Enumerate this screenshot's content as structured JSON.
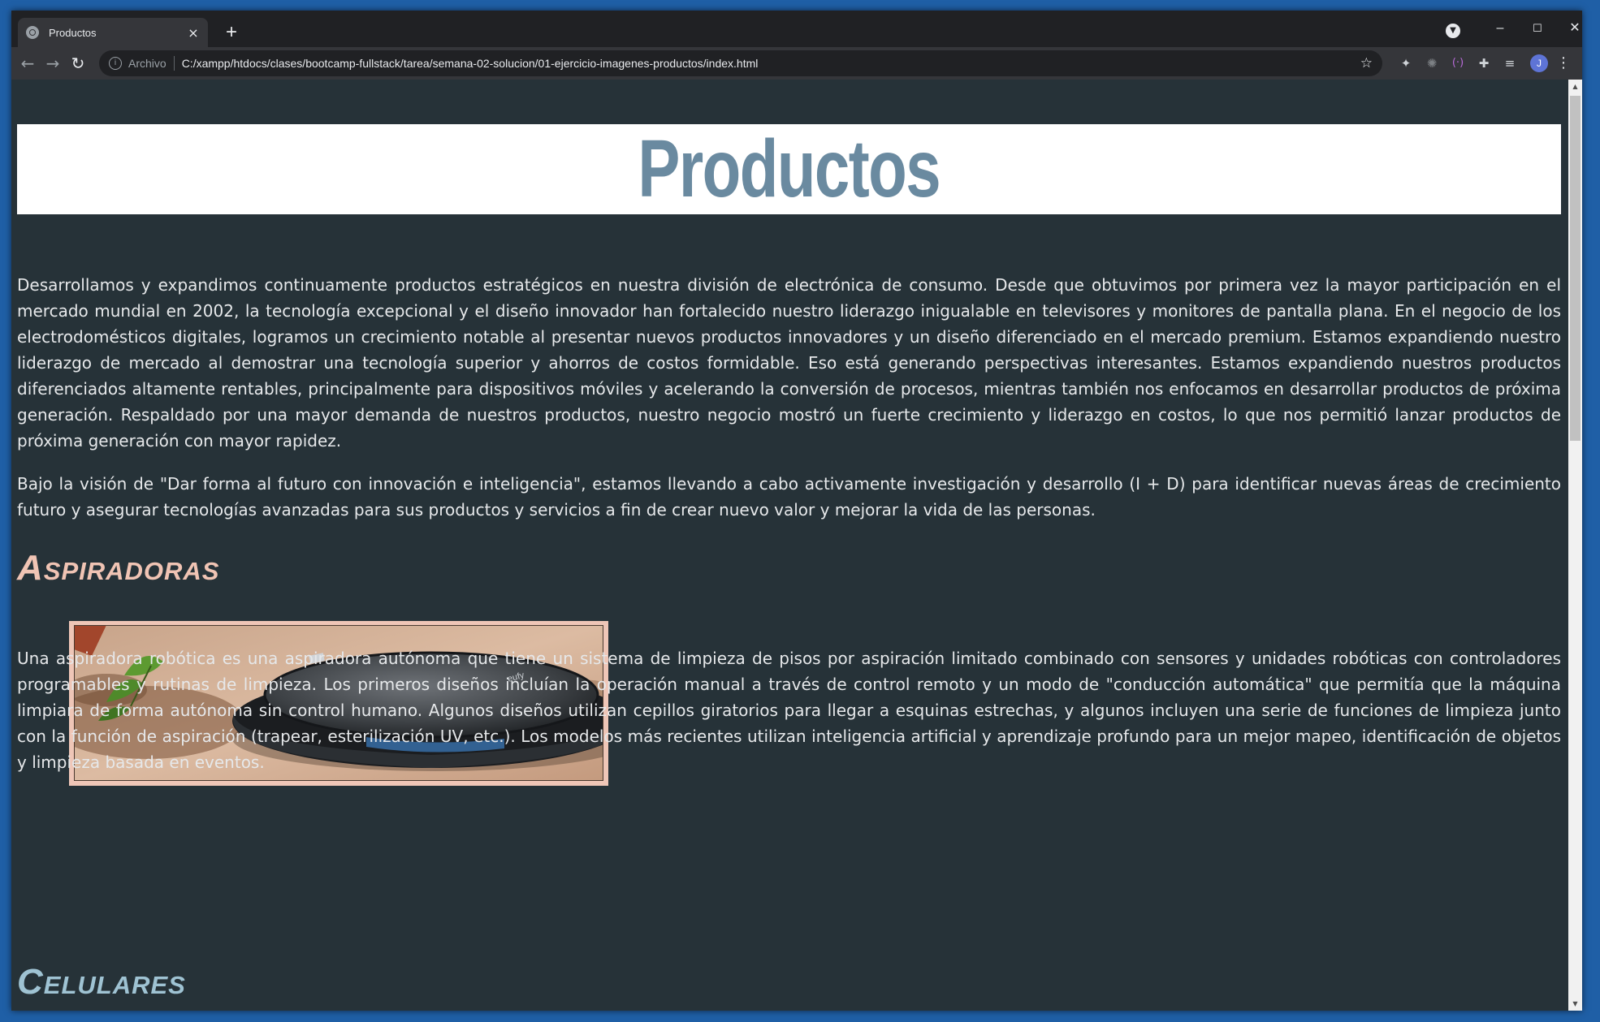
{
  "browser": {
    "tab_title": "Productos",
    "tab_close": "×",
    "new_tab": "+",
    "security_label": "Archivo",
    "url": "C:/xampp/htdocs/clases/bootcamp-fullstack/tarea/semana-02-solucion/01-ejercicio-imagenes-productos/index.html",
    "profile_initial": "J",
    "window_controls": {
      "minimize": "–",
      "maximize": "☐",
      "close": "✕"
    }
  },
  "page": {
    "title": "Productos",
    "intro_paragraphs": [
      "Desarrollamos y expandimos continuamente productos estratégicos en nuestra división de electrónica de consumo. Desde que obtuvimos por primera vez la mayor participación en el mercado mundial en 2002, la tecnología excepcional y el diseño innovador han fortalecido nuestro liderazgo inigualable en televisores y monitores de pantalla plana. En el negocio de los electrodomésticos digitales, logramos un crecimiento notable al presentar nuevos productos innovadores y un diseño diferenciado en el mercado premium. Estamos expandiendo nuestro liderazgo de mercado al demostrar una tecnología superior y ahorros de costos formidable. Eso está generando perspectivas interesantes. Estamos expandiendo nuestros productos diferenciados altamente rentables, principalmente para dispositivos móviles y acelerando la conversión de procesos, mientras también nos enfocamos en desarrollar productos de próxima generación. Respaldado por una mayor demanda de nuestros productos, nuestro negocio mostró un fuerte crecimiento y liderazgo en costos, lo que nos permitió lanzar productos de próxima generación con mayor rapidez.",
      "Bajo la visión de \"Dar forma al futuro con innovación e inteligencia\", estamos llevando a cabo activamente investigación y desarrollo (I + D) para identificar nuevas áreas de crecimiento futuro y asegurar tecnologías avanzadas para sus productos y servicios a fin de crear nuevo valor y mejorar la vida de las personas."
    ],
    "sections": [
      {
        "title": "Aspiradoras",
        "title_color": "#f0c4b4",
        "text": "Una aspiradora robótica es una aspiradora autónoma que tiene un sistema de limpieza de pisos por aspiración limitado combinado con sensores y unidades robóticas con controladores programables y rutinas de limpieza. Los primeros diseños incluían la operación manual a través de control remoto y un modo de \"conducción automática\" que permitía que la máquina limpiara de forma autónoma sin control humano. Algunos diseños utilizan cepillos giratorios para llegar a esquinas estrechas, y algunos incluyen una serie de funciones de limpieza junto con la función de aspiración (trapear, esterilización UV, etc.). Los modelos más recientes utilizan inteligencia artificial y aprendizaje profundo para un mejor mapeo, identificación de objetos y limpieza basada en eventos."
      },
      {
        "title": "Celulares",
        "title_color": "#9fc3d3"
      }
    ]
  },
  "colors": {
    "page_background": "#263238",
    "title_text": "#6a8aa0",
    "header_background": "#ffffff",
    "body_text": "#e6e8ea",
    "image_frame": "#efc6b7"
  }
}
